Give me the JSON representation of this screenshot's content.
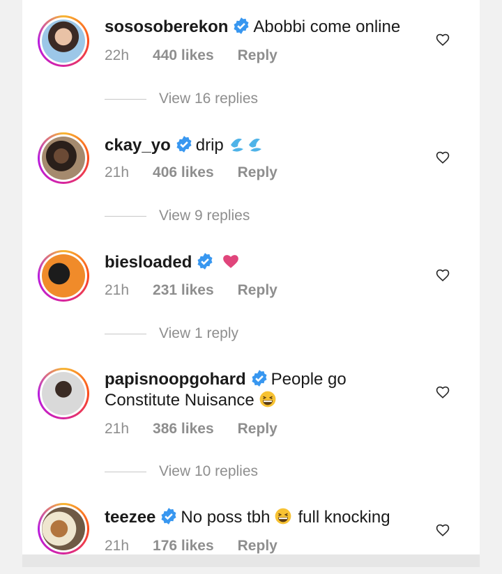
{
  "comments": [
    {
      "username": "sososoberekon",
      "text": "Abobbi come online",
      "time": "22h",
      "likes": "440 likes",
      "reply": "Reply",
      "view_replies": "View 16 replies"
    },
    {
      "username": "ckay_yo",
      "text": "drip",
      "time": "21h",
      "likes": "406 likes",
      "reply": "Reply",
      "view_replies": "View 9 replies"
    },
    {
      "username": "biesloaded",
      "text": "",
      "time": "21h",
      "likes": "231 likes",
      "reply": "Reply",
      "view_replies": "View 1 reply"
    },
    {
      "username": "papisnoopgohard",
      "text": "People  go",
      "text2": "Constitute  Nuisance",
      "time": "21h",
      "likes": "386 likes",
      "reply": "Reply",
      "view_replies": "View 10 replies"
    },
    {
      "username": "teezee",
      "text": "No poss tbh",
      "text2": "full knocking",
      "time": "21h",
      "likes": "176 likes",
      "reply": "Reply"
    }
  ],
  "icons": {
    "verified": "verified-badge-icon",
    "heart": "heart-outline-icon",
    "droplets": "droplets-emoji",
    "red_heart": "red-heart-emoji",
    "grin": "grinning-squint-emoji"
  },
  "colors": {
    "verified": "#3897f0",
    "meta": "#8e8e8e",
    "text": "#1a1a1a",
    "heart_emoji": "#e0457b"
  }
}
